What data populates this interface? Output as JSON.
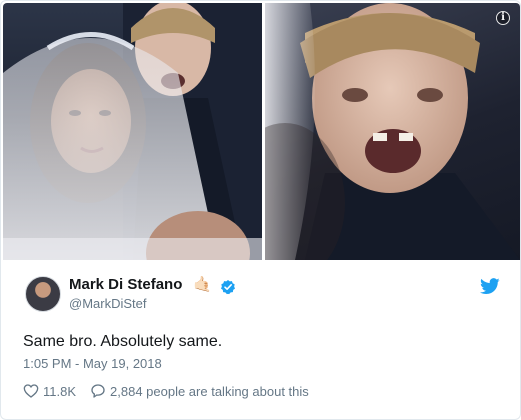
{
  "tweet": {
    "author_name": "Mark Di Stefano",
    "author_emoji": "🤙🏻",
    "author_handle": "@MarkDiStef",
    "text": "Same bro. Absolutely same.",
    "timestamp": "1:05 PM - May 19, 2018",
    "like_count": "11.8K",
    "talking_text": "2,884 people are talking about this"
  },
  "icons": {
    "verified": "verified-check-icon",
    "platform": "twitter-bird-icon",
    "like": "heart-icon",
    "reply": "speech-bubble-icon",
    "info": "info-icon"
  },
  "colors": {
    "accent": "#1da1f2",
    "secondary_text": "#657786",
    "primary_text": "#14171a"
  }
}
